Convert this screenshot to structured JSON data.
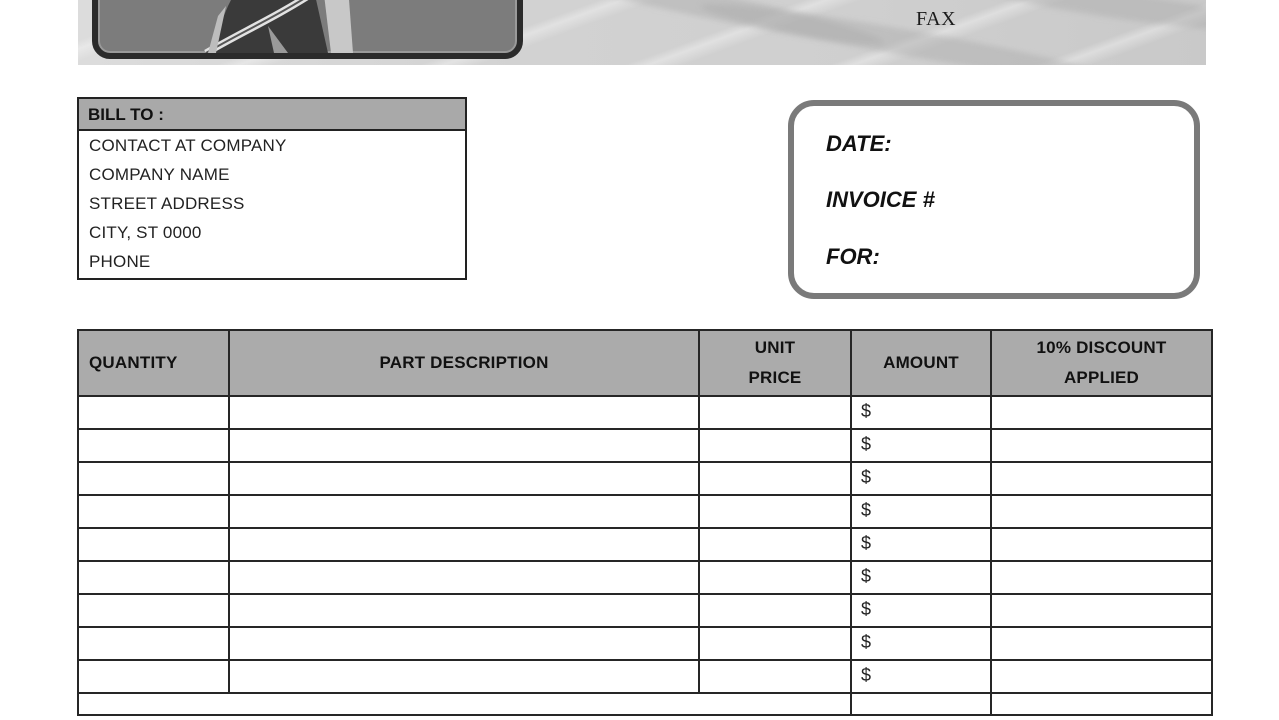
{
  "header": {
    "contact_label": "FAX",
    "logo_icon": "logo-artwork-icon"
  },
  "bill_to": {
    "heading": "BILL TO :",
    "lines": [
      "CONTACT AT COMPANY",
      "COMPANY NAME",
      "STREET ADDRESS",
      "CITY, ST 0000",
      "PHONE"
    ]
  },
  "invoice_info": {
    "date_label": "DATE:",
    "invoice_number_label": "INVOICE #",
    "for_label": "FOR:"
  },
  "items_table": {
    "columns": [
      "QUANTITY",
      "PART DESCRIPTION",
      "UNIT PRICE",
      "AMOUNT",
      "10% DISCOUNT APPLIED"
    ],
    "column_lines": {
      "unit_price": [
        "UNIT",
        "PRICE"
      ],
      "discount": [
        "10% DISCOUNT",
        "APPLIED"
      ]
    },
    "rows": [
      {
        "quantity": "",
        "description": "",
        "unit_price": "",
        "amount": "$",
        "discount": ""
      },
      {
        "quantity": "",
        "description": "",
        "unit_price": "",
        "amount": "$",
        "discount": ""
      },
      {
        "quantity": "",
        "description": "",
        "unit_price": "",
        "amount": "$",
        "discount": ""
      },
      {
        "quantity": "",
        "description": "",
        "unit_price": "",
        "amount": "$",
        "discount": ""
      },
      {
        "quantity": "",
        "description": "",
        "unit_price": "",
        "amount": "$",
        "discount": ""
      },
      {
        "quantity": "",
        "description": "",
        "unit_price": "",
        "amount": "$",
        "discount": ""
      },
      {
        "quantity": "",
        "description": "",
        "unit_price": "",
        "amount": "$",
        "discount": ""
      },
      {
        "quantity": "",
        "description": "",
        "unit_price": "",
        "amount": "$",
        "discount": ""
      },
      {
        "quantity": "",
        "description": "",
        "unit_price": "",
        "amount": "$",
        "discount": ""
      }
    ]
  },
  "colors": {
    "header_fill": "#ababab",
    "info_border": "#7a7a7a",
    "grid_line": "#262626"
  }
}
